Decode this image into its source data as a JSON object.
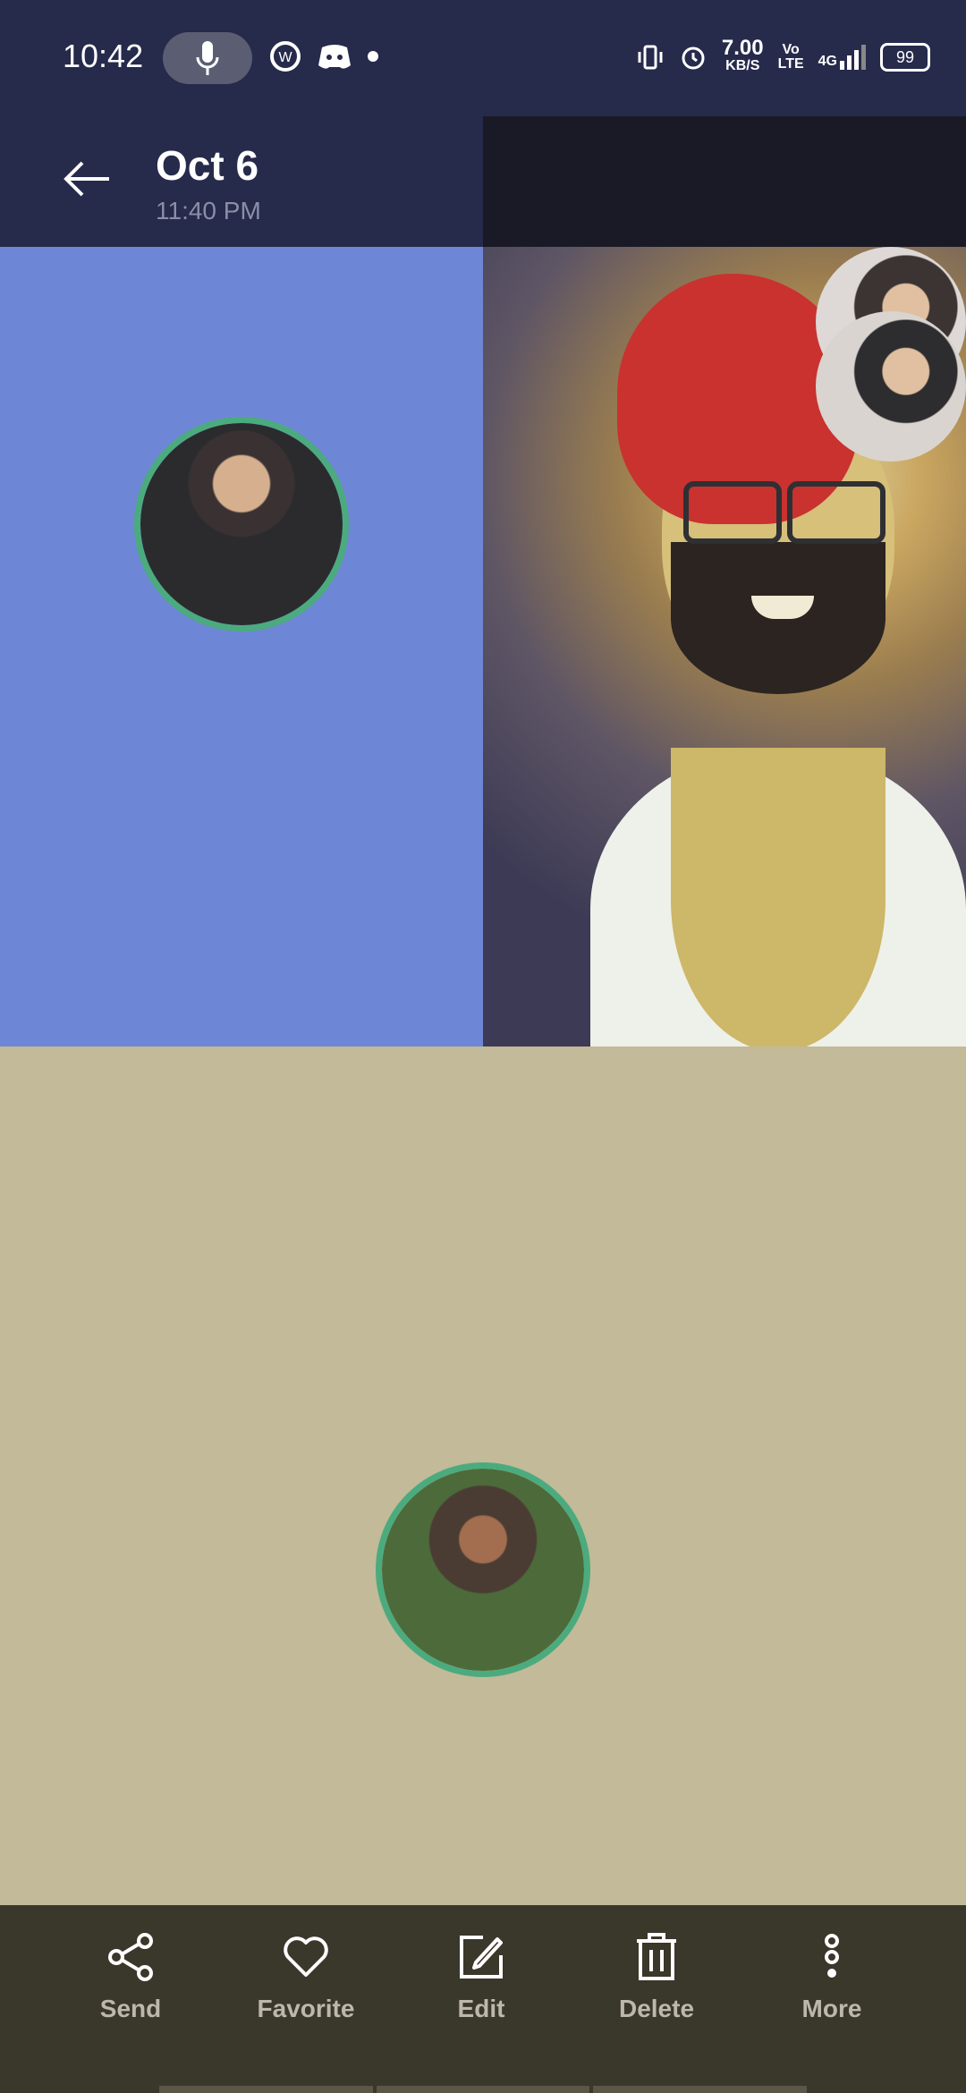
{
  "status_bar": {
    "time": "10:42",
    "network_speed_value": "7.00",
    "network_speed_unit": "KB/S",
    "volte": "Vo\nLTE",
    "network_type": "4G",
    "battery": "99",
    "icons": [
      "mic-icon",
      "cloud-icon",
      "whatsapp-business-icon",
      "discord-icon",
      "dot-icon",
      "vibrate-icon",
      "alarm-icon",
      "signal-icon",
      "battery-icon"
    ]
  },
  "header": {
    "title": "Oct 6",
    "subtitle": "11:40 PM"
  },
  "tiles": {
    "left_bg": "#6e86d6",
    "bottom_bg": "#c2ba98"
  },
  "actions": [
    {
      "label": "Send",
      "icon": "share-icon"
    },
    {
      "label": "Favorite",
      "icon": "heart-icon"
    },
    {
      "label": "Edit",
      "icon": "edit-icon"
    },
    {
      "label": "Delete",
      "icon": "trash-icon"
    },
    {
      "label": "More",
      "icon": "more-vertical-icon"
    }
  ],
  "colors": {
    "accent_ring": "#4bab7e",
    "header_bg": "#262a4b",
    "action_bar_bg": "#3a372b"
  }
}
